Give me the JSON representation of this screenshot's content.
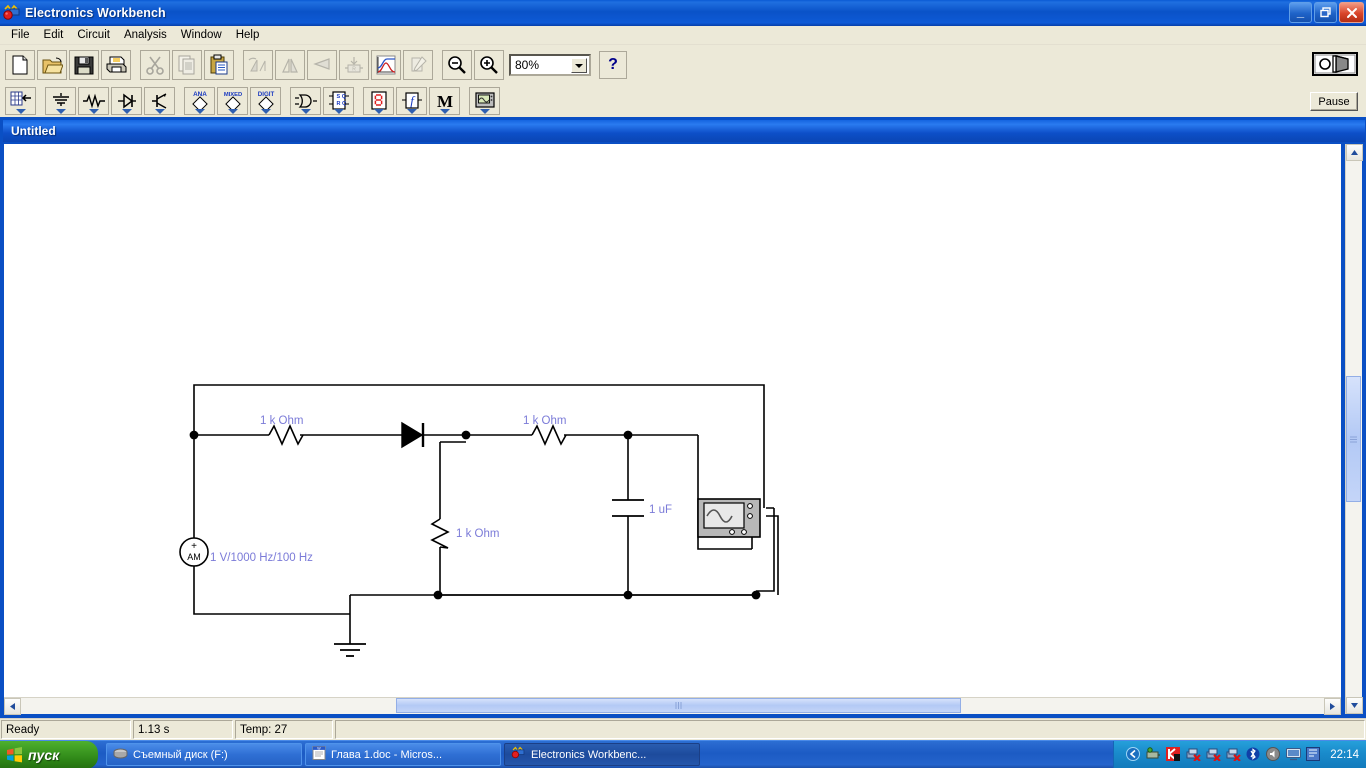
{
  "app": {
    "title": "Electronics Workbench",
    "icon": "ewb-logo-icon"
  },
  "window_controls": {
    "minimize": "_",
    "restore": "❐",
    "close": "✕"
  },
  "menu": {
    "items": [
      {
        "label": "File"
      },
      {
        "label": "Edit"
      },
      {
        "label": "Circuit"
      },
      {
        "label": "Analysis"
      },
      {
        "label": "Window"
      },
      {
        "label": "Help"
      }
    ]
  },
  "toolbar_main": {
    "buttons": [
      {
        "name": "new-file-button",
        "icon": "new-document-icon",
        "enabled": true
      },
      {
        "name": "open-file-button",
        "icon": "open-folder-icon",
        "enabled": true
      },
      {
        "name": "save-file-button",
        "icon": "floppy-save-icon",
        "enabled": true
      },
      {
        "name": "print-button",
        "icon": "printer-icon",
        "enabled": true
      },
      {
        "name": "cut-button",
        "icon": "scissors-icon",
        "enabled": false
      },
      {
        "name": "copy-button",
        "icon": "copy-pages-icon",
        "enabled": false
      },
      {
        "name": "paste-button",
        "icon": "clipboard-paste-icon",
        "enabled": true
      },
      {
        "name": "rotate-button",
        "icon": "rotate-icon",
        "enabled": false
      },
      {
        "name": "flip-horizontal-button",
        "icon": "flip-horizontal-icon",
        "enabled": false
      },
      {
        "name": "flip-vertical-button",
        "icon": "flip-vertical-icon",
        "enabled": false
      },
      {
        "name": "create-subcircuit-button",
        "icon": "subcircuit-icon",
        "enabled": false
      },
      {
        "name": "analysis-graph-button",
        "icon": "analysis-graph-icon",
        "enabled": true
      },
      {
        "name": "component-properties-button",
        "icon": "properties-pen-icon",
        "enabled": false
      },
      {
        "name": "zoom-out-button",
        "icon": "magnifier-minus-icon",
        "enabled": true
      },
      {
        "name": "zoom-in-button",
        "icon": "magnifier-plus-icon",
        "enabled": true
      }
    ],
    "zoom_value": "80%",
    "help_label": "?"
  },
  "toolbar_parts": {
    "buttons": [
      {
        "name": "favorites-bin-button",
        "icon": "parts-bin-icon",
        "label": ""
      },
      {
        "name": "sources-button",
        "icon": "sources-icon",
        "label": ""
      },
      {
        "name": "basic-button",
        "icon": "resistor-icon",
        "label": ""
      },
      {
        "name": "diodes-button",
        "icon": "diode-icon",
        "label": ""
      },
      {
        "name": "transistors-button",
        "icon": "transistor-icon",
        "label": ""
      },
      {
        "name": "analog-ics-button",
        "icon": "analog-ic-icon",
        "label": "ANA"
      },
      {
        "name": "mixed-ics-button",
        "icon": "mixed-ic-icon",
        "label": "MIXED"
      },
      {
        "name": "digital-ics-button",
        "icon": "digital-ic-icon",
        "label": "DIGIT"
      },
      {
        "name": "logic-gates-button",
        "icon": "logic-gate-icon",
        "label": ""
      },
      {
        "name": "digital-button",
        "icon": "flipflop-icon",
        "label": "SQRQ"
      },
      {
        "name": "indicators-button",
        "icon": "seven-segment-icon",
        "label": ""
      },
      {
        "name": "controls-button",
        "icon": "function-block-icon",
        "label": "f"
      },
      {
        "name": "miscellaneous-button",
        "icon": "letter-m-icon",
        "label": "M"
      },
      {
        "name": "instruments-button",
        "icon": "instrument-icon",
        "label": ""
      }
    ]
  },
  "simulation": {
    "power_switch_name": "power-switch-toggle",
    "pause_label": "Pause"
  },
  "mdi_window": {
    "title": "Untitled"
  },
  "circuit": {
    "labels": {
      "r1": "1 k Ohm",
      "r2": "1 k Ohm",
      "r3": "1 k Ohm",
      "c1": "1 uF",
      "source": "1 V/1000 Hz/100 Hz",
      "source_symbol": "AM",
      "source_polarity": "+"
    },
    "label_color": "#7b7bd8",
    "wire_color": "#000000"
  },
  "scrollbars": {
    "up_arrow": "▲",
    "down_arrow": "▼",
    "left_arrow": "◀",
    "right_arrow": "▶",
    "grip": "≡"
  },
  "statusbar": {
    "state": "Ready",
    "time": "1.13 s",
    "temperature": "Temp:  27",
    "extra": ""
  },
  "taskbar": {
    "start_label": "пуск",
    "tasks": [
      {
        "label": "Съемный диск (F:)",
        "icon": "removable-disk-icon",
        "active": false
      },
      {
        "label": "Глава 1.doc - Micros...",
        "icon": "word-document-icon",
        "active": false
      },
      {
        "label": "Electronics Workbenc...",
        "icon": "ewb-logo-icon",
        "active": true
      }
    ],
    "tray_icons": [
      "show-hidden-icons-icon",
      "safely-remove-hardware-icon",
      "kaspersky-icon",
      "network-disconnected-1-icon",
      "network-disconnected-2-icon",
      "network-disconnected-3-icon",
      "bluetooth-icon",
      "volume-icon",
      "display-icon",
      "language-bar-icon"
    ],
    "clock": "22:14"
  }
}
